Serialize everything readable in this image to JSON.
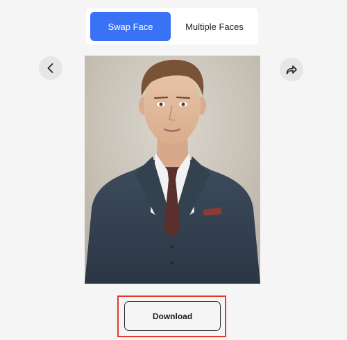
{
  "tabs": {
    "swap_face": "Swap Face",
    "multiple_faces": "Multiple Faces"
  },
  "navigation": {
    "prev_icon": "chevron-left-icon",
    "share_icon": "share-arrow-icon"
  },
  "result_image": {
    "alt": "Generated portrait of a young man in a dark suit"
  },
  "actions": {
    "download_label": "Download"
  },
  "colors": {
    "accent": "#3a72f5",
    "highlight": "#e8362d"
  }
}
